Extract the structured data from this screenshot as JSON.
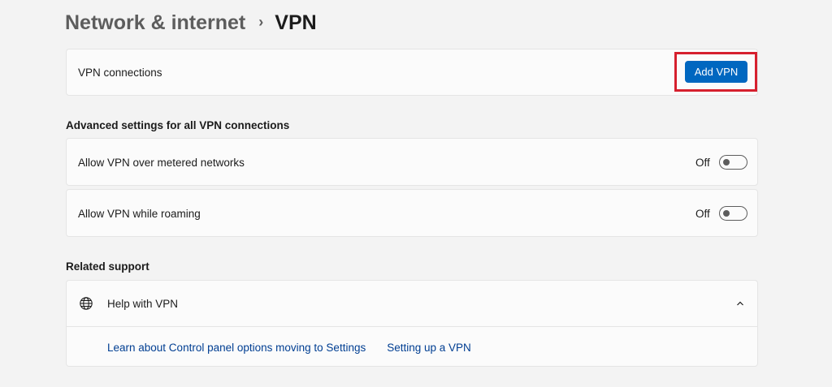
{
  "breadcrumb": {
    "parent": "Network & internet",
    "separator": "›",
    "current": "VPN"
  },
  "vpn_connections": {
    "label": "VPN connections",
    "add_button_label": "Add VPN"
  },
  "advanced_settings": {
    "title": "Advanced settings for all VPN connections",
    "items": [
      {
        "label": "Allow VPN over metered networks",
        "state_label": "Off",
        "on": false
      },
      {
        "label": "Allow VPN while roaming",
        "state_label": "Off",
        "on": false
      }
    ]
  },
  "related_support": {
    "title": "Related support",
    "help": {
      "icon": "globe-icon",
      "label": "Help with VPN",
      "expanded": true,
      "links": [
        "Learn about Control panel options moving to Settings",
        "Setting up a VPN"
      ]
    }
  },
  "colors": {
    "accent": "#0067c0",
    "highlight": "#d6202e",
    "link": "#003e92"
  }
}
